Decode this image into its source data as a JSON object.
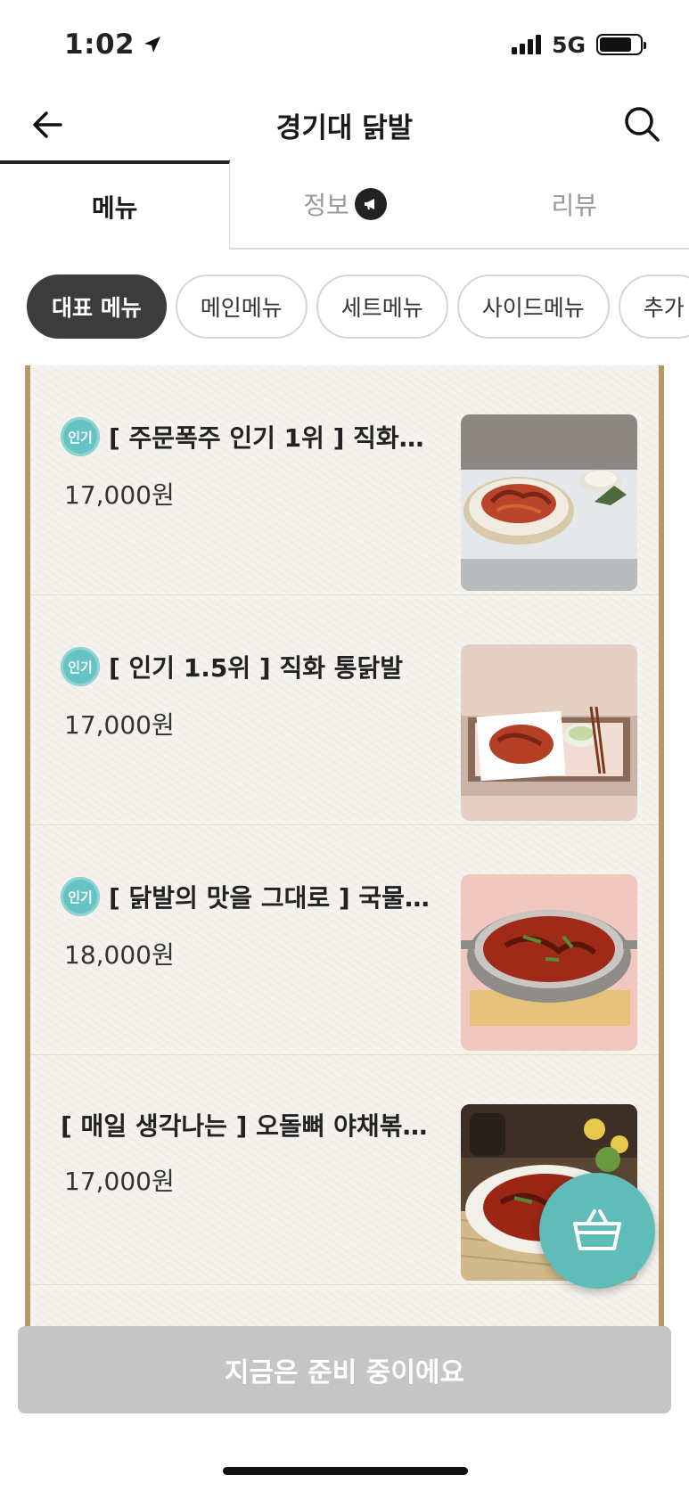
{
  "status_bar": {
    "time": "1:02",
    "network": "5G",
    "battery_level": 0.8,
    "signal_bars": 4
  },
  "nav": {
    "title": "경기대 닭발",
    "back_icon": "arrow-left-icon",
    "search_icon": "search-icon"
  },
  "tabs": [
    {
      "label": "메뉴",
      "active": true
    },
    {
      "label": "정보",
      "active": false,
      "icon": "megaphone-icon"
    },
    {
      "label": "리뷰",
      "active": false
    }
  ],
  "categories": [
    {
      "label": "대표 메뉴",
      "selected": true
    },
    {
      "label": "메인메뉴",
      "selected": false
    },
    {
      "label": "세트메뉴",
      "selected": false
    },
    {
      "label": "사이드메뉴",
      "selected": false
    },
    {
      "label": "추가",
      "selected": false
    }
  ],
  "menu_items": [
    {
      "badge": "인기",
      "name": "[ 주문폭주 인기 1위 ] 직화…",
      "price": "17,000원",
      "image": "spicy-chicken-feet-plate"
    },
    {
      "badge": "인기",
      "name": "[ 인기 1.5위 ] 직화 통닭발",
      "price": "17,000원",
      "image": "chicken-feet-tray"
    },
    {
      "badge": "인기",
      "name": "[ 닭발의 맛을 그대로 ] 국물…",
      "price": "18,000원",
      "image": "chicken-feet-stew-pot"
    },
    {
      "badge": "",
      "name": "[ 매일 생각나는 ] 오돌뼈 야채볶…",
      "price": "17,000원",
      "image": "cartilage-stir-fry"
    }
  ],
  "cart_button": {
    "icon": "basket-icon",
    "color": "#5fbcb8"
  },
  "bottom_bar": {
    "label": "지금은 준비 중이에요"
  },
  "colors": {
    "accent": "#5fbcb8",
    "badge": "#66c3c3",
    "frame": "#b49868",
    "disabled": "#c5c5c5"
  }
}
